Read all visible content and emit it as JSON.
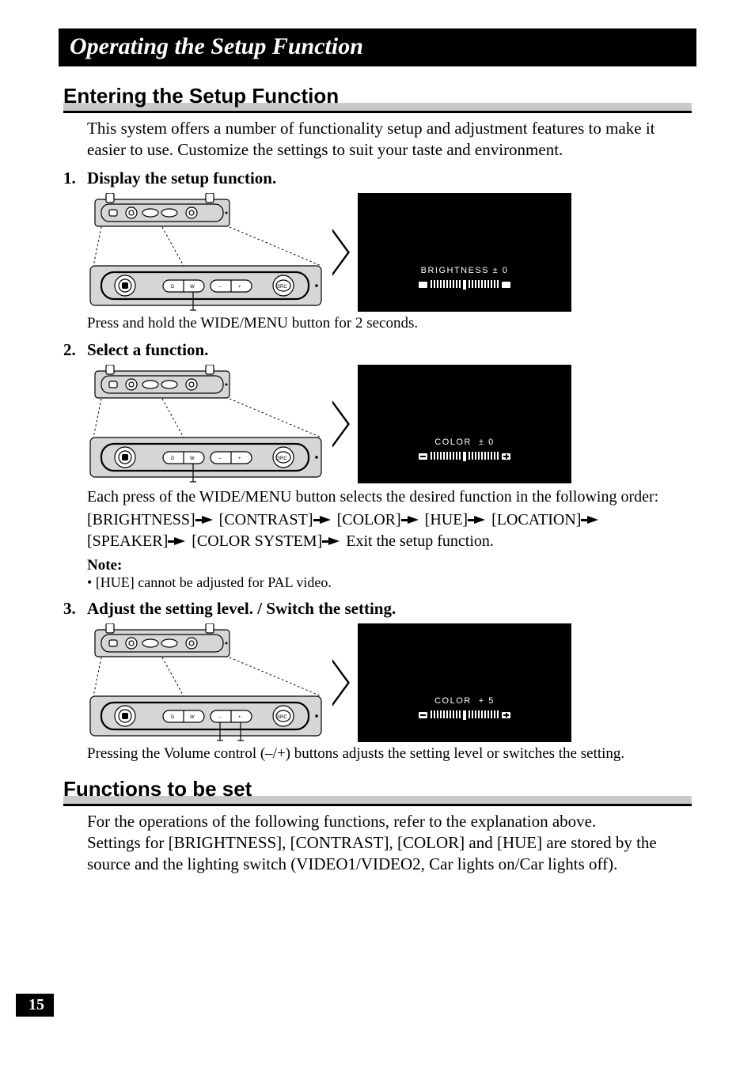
{
  "chapter_title": "Operating the Setup Function",
  "section1": {
    "heading": "Entering the Setup Function",
    "intro": "This system offers a number of functionality setup and adjustment features to make it easier to use. Customize the settings to suit your taste and environment."
  },
  "step1": {
    "num": "1.",
    "title": "Display the setup function.",
    "screen_label": "BRIGHTNESS ± 0",
    "caption": "Press and hold the WIDE/MENU button for 2 seconds."
  },
  "step2": {
    "num": "2.",
    "title": "Select a function.",
    "screen_label": "COLOR  ± 0",
    "desc": "Each press of the WIDE/MENU button selects the desired function in the following order:",
    "seq": [
      "[BRIGHTNESS]",
      "[CONTRAST]",
      "[COLOR]",
      "[HUE]",
      "[LOCATION]",
      "[SPEAKER]",
      "[COLOR SYSTEM]"
    ],
    "seq_tail": "Exit the setup function.",
    "note_title": "Note:",
    "note_item": "[HUE] cannot be adjusted for PAL video."
  },
  "step3": {
    "num": "3.",
    "title": "Adjust the setting level. / Switch the setting.",
    "screen_label": "COLOR  + 5",
    "caption": "Pressing the Volume control (–/+) buttons adjusts the setting level or switches the setting."
  },
  "section2": {
    "heading": "Functions to be set",
    "body": "For the operations of the following functions, refer to the explanation above.\nSettings for [BRIGHTNESS], [CONTRAST], [COLOR] and [HUE] are stored by the source and the lighting switch (VIDEO1/VIDEO2, Car lights on/Car lights off)."
  },
  "page_number": "15",
  "remote_labels": {
    "d": "D",
    "w": "W",
    "src": "SRC",
    "minus": "–",
    "plus": "+"
  }
}
